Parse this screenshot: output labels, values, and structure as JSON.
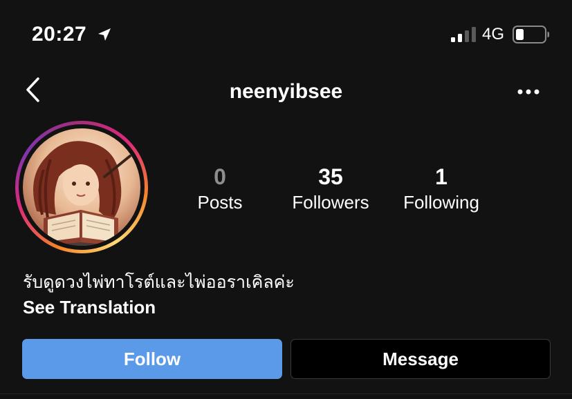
{
  "status_bar": {
    "time": "20:27",
    "location_icon": "location-arrow-icon",
    "signal_icon": "cellular-signal-icon",
    "network": "4G",
    "battery_icon": "battery-low-icon"
  },
  "header": {
    "username": "neenyibsee",
    "back_icon": "chevron-left-icon",
    "more_icon": "more-horizontal-icon"
  },
  "profile": {
    "avatar_icon": "profile-avatar-illustration",
    "stats": [
      {
        "value": "0",
        "label": "Posts"
      },
      {
        "value": "35",
        "label": "Followers"
      },
      {
        "value": "1",
        "label": "Following"
      }
    ],
    "bio": "รับดูดวงไพ่ทาโรต์และไพ่ออราเคิลค่ะ",
    "see_translation": "See Translation"
  },
  "actions": {
    "follow_label": "Follow",
    "message_label": "Message"
  },
  "colors": {
    "background": "#121212",
    "follow_button": "#5b9ae8",
    "muted_number": "#8e8e8e",
    "story_ring_start": "#f58529",
    "story_ring_end": "#8134af"
  }
}
